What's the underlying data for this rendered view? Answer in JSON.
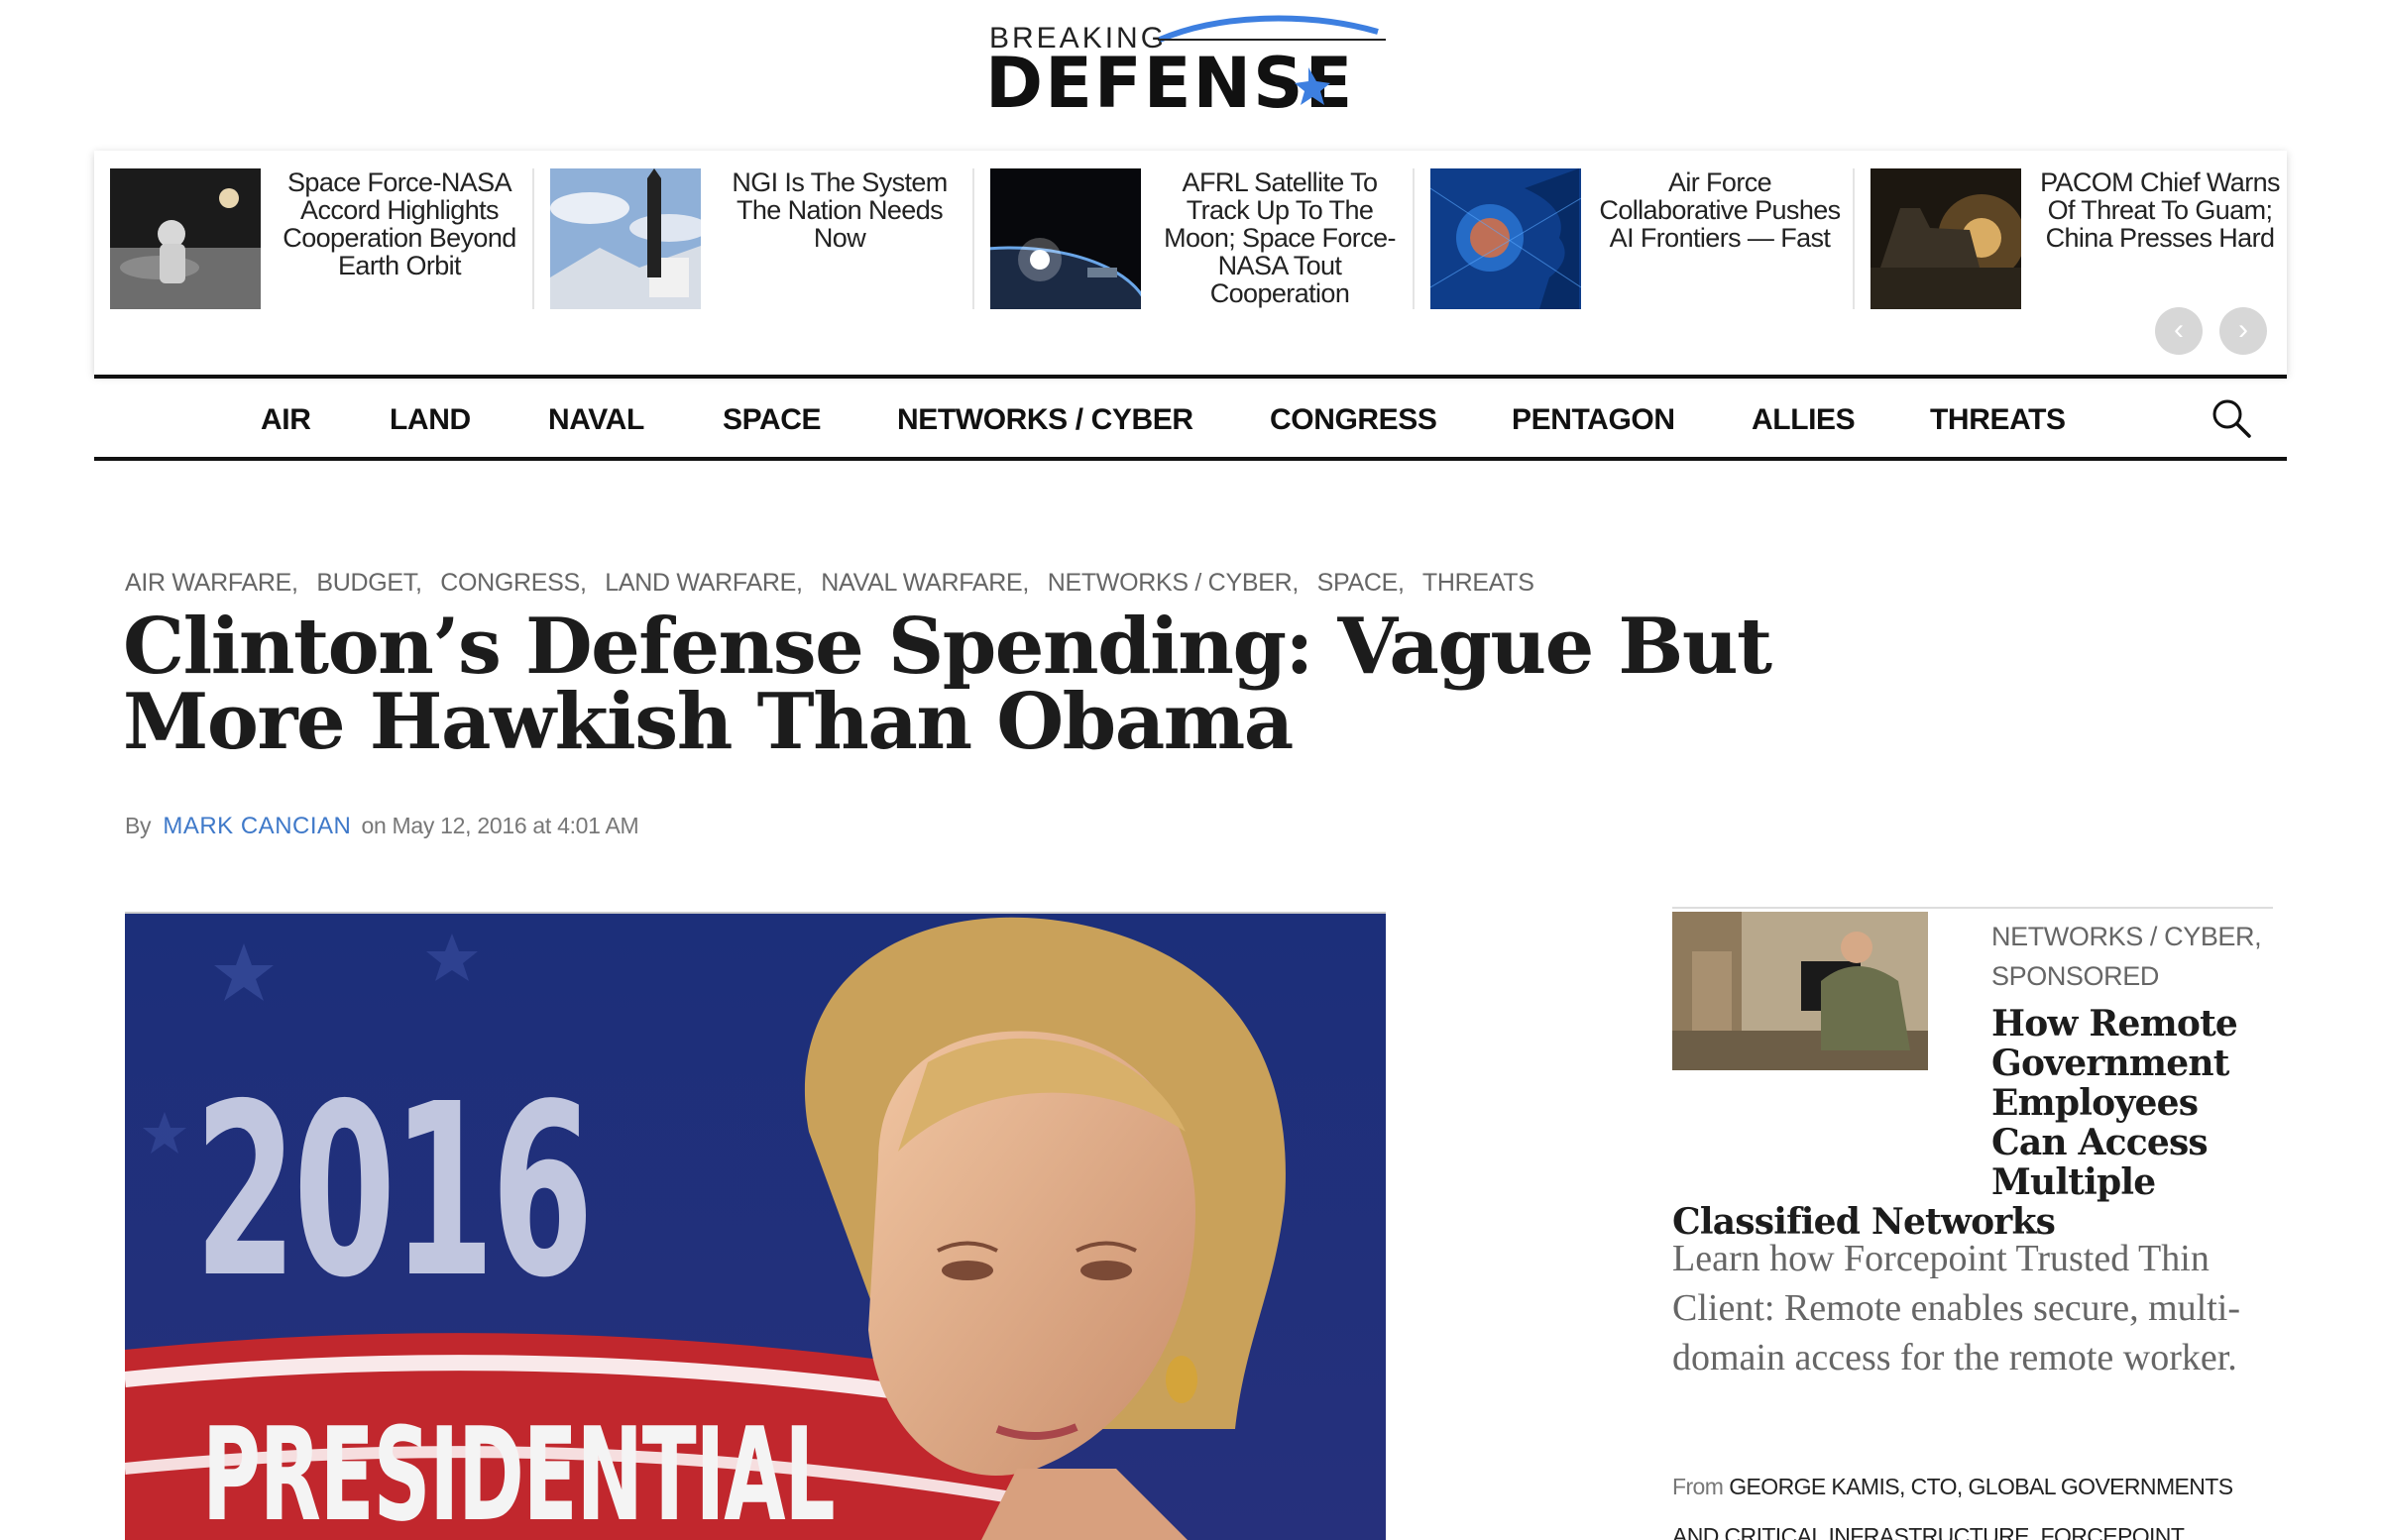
{
  "logo": {
    "line1": "BREAKING",
    "line2": "DEFENSE"
  },
  "carousel": {
    "items": [
      {
        "title": "Space Force-NASA Accord Highlights Cooperation Beyond Earth Orbit",
        "image": "astronaut-moon"
      },
      {
        "title": "NGI Is The System The Nation Needs Now",
        "image": "missile-launch"
      },
      {
        "title": "AFRL Satellite To Track Up To The Moon; Space Force-NASA Tout Cooperation",
        "image": "earth-orbit"
      },
      {
        "title": "Air Force Collaborative Pushes AI Frontiers — Fast",
        "image": "ai-brain"
      },
      {
        "title": "PACOM Chief Warns Of Threat To Guam; China Presses Hard",
        "image": "ship-night"
      }
    ],
    "prev_icon": "chevron-left-icon",
    "next_icon": "chevron-right-icon"
  },
  "nav": {
    "items": [
      "AIR",
      "LAND",
      "NAVAL",
      "SPACE",
      "NETWORKS / CYBER",
      "CONGRESS",
      "PENTAGON",
      "ALLIES",
      "THREATS"
    ],
    "search_icon": "search-icon"
  },
  "article": {
    "categories": [
      "AIR WARFARE",
      "BUDGET",
      "CONGRESS",
      "LAND WARFARE",
      "NAVAL WARFARE",
      "NETWORKS / CYBER",
      "SPACE",
      "THREATS"
    ],
    "title": "Clinton’s Defense Spending: Vague But More Hawkish Than Obama",
    "byline": {
      "by": "By",
      "author": "MARK CANCIAN",
      "on": "on May 12, 2016 at 4:01 AM"
    },
    "hero": {
      "year_text": "2016",
      "caption_text": "PRESIDENTIAL"
    }
  },
  "sponsored": {
    "categories": "NETWORKS / CYBER, SPONSORED",
    "title": "How Remote Government Employees Can Access Multiple Classified Networks",
    "description": "Learn how Forcepoint Trusted Thin Client: Remote enables secure, multi-domain access for the remote worker.",
    "from_label": "From",
    "from_text": "GEORGE KAMIS, CTO, GLOBAL GOVERNMENTS AND CRITICAL INFRASTRUCTURE, FORCEPOINT"
  },
  "colors": {
    "accent_blue": "#3f79c9",
    "nav_border": "#111111",
    "heading": "#1c1c1c"
  }
}
